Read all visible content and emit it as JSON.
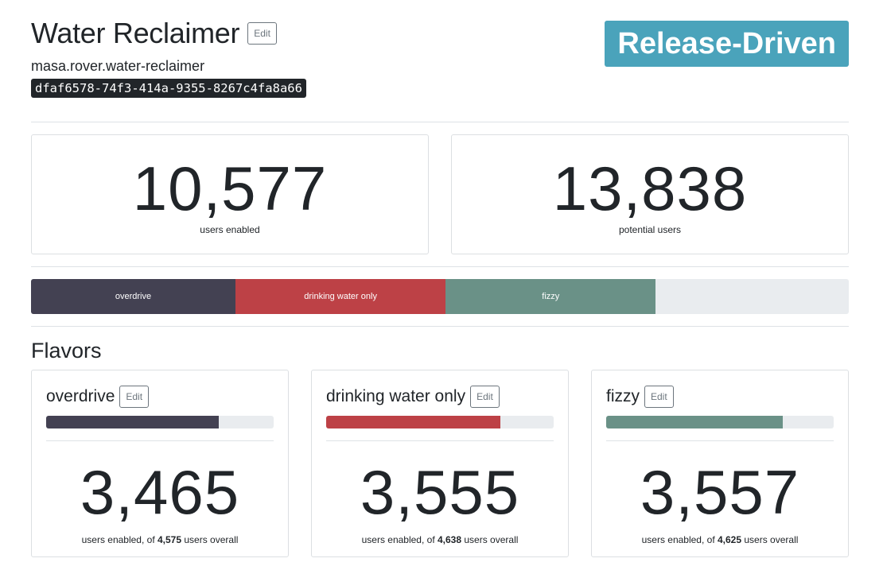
{
  "feature": {
    "name": "Water Reclaimer",
    "edit_label": "Edit",
    "key": "masa.rover.water-reclaimer",
    "uuid": "dfaf6578-74f3-414a-9355-8267c4fa8a66",
    "mode": "Release-Driven",
    "mode_color": "#4aa3bb"
  },
  "stats": {
    "enabled_count": "10,577",
    "enabled_label": "users enabled",
    "potential_count": "13,838",
    "potential_label": "potential users"
  },
  "distribution": [
    {
      "label": "overdrive",
      "color": "#434152",
      "fraction": 0.25
    },
    {
      "label": "drinking water only",
      "color": "#bd4146",
      "fraction": 0.257
    },
    {
      "label": "fizzy",
      "color": "#6a9187",
      "fraction": 0.257
    }
  ],
  "flavors_title": "Flavors",
  "flavors": [
    {
      "name": "overdrive",
      "edit_label": "Edit",
      "color": "#434152",
      "enabled": "3,465",
      "sub_prefix": "users enabled, of",
      "overall": "4,575",
      "sub_suffix": "users overall",
      "fraction": 0.757
    },
    {
      "name": "drinking water only",
      "edit_label": "Edit",
      "color": "#bd4146",
      "enabled": "3,555",
      "sub_prefix": "users enabled, of",
      "overall": "4,638",
      "sub_suffix": "users overall",
      "fraction": 0.767
    },
    {
      "name": "fizzy",
      "edit_label": "Edit",
      "color": "#6a9187",
      "enabled": "3,557",
      "sub_prefix": "users enabled, of",
      "overall": "4,625",
      "sub_suffix": "users overall",
      "fraction": 0.775
    }
  ]
}
